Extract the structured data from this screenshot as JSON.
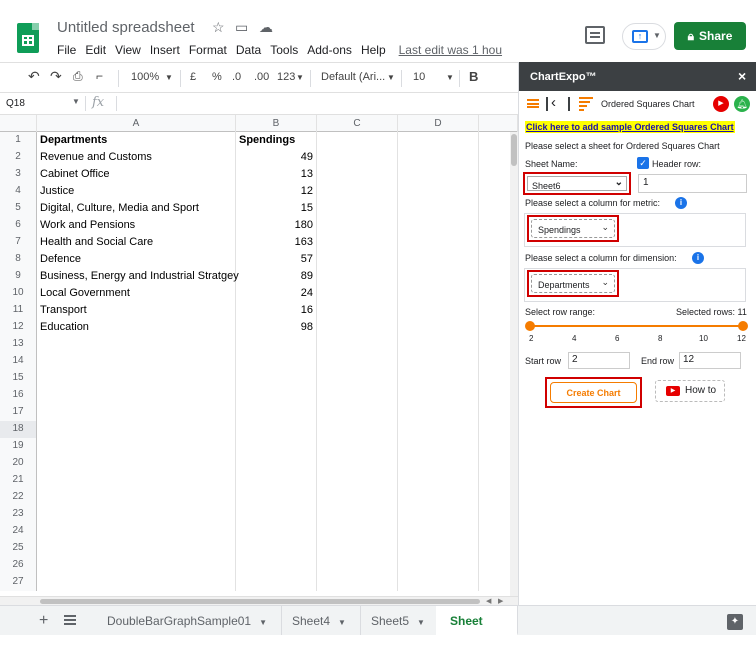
{
  "titlebar": {
    "doc_title": "Untitled spreadsheet",
    "menu": [
      "File",
      "Edit",
      "View",
      "Insert",
      "Format",
      "Data",
      "Tools",
      "Add-ons",
      "Help"
    ],
    "last_edit": "Last edit was 1 hou",
    "share_label": "Share"
  },
  "toolbar": {
    "zoom": "100%",
    "currency": "£",
    "percent": "%",
    "dec_decrease": ".0",
    "dec_increase": ".00",
    "number_format": "123",
    "font": "Default (Ari...",
    "font_size": "10",
    "bold": "B"
  },
  "formula_bar": {
    "cell_ref": "Q18",
    "fx": "fx",
    "value": ""
  },
  "grid": {
    "columns": [
      "A",
      "B",
      "C",
      "D"
    ],
    "header": [
      "Departments",
      "Spendings"
    ],
    "data": [
      [
        "Revenue and Customs",
        "49"
      ],
      [
        "Cabinet Office",
        "13"
      ],
      [
        "Justice",
        "12"
      ],
      [
        "Digital, Culture, Media and Sport",
        "15"
      ],
      [
        "Work and Pensions",
        "180"
      ],
      [
        "Health and Social Care",
        "163"
      ],
      [
        "Defence",
        "57"
      ],
      [
        "Business, Energy and Industrial Stratgey",
        "89"
      ],
      [
        "Local Government",
        "24"
      ],
      [
        "Transport",
        "16"
      ],
      [
        "Education",
        "98"
      ]
    ],
    "row_count": 27,
    "selected_row": 18
  },
  "tabs": {
    "sheets": [
      "DoubleBarGraphSample01",
      "Sheet4",
      "Sheet5",
      "Sheet"
    ],
    "active": "Sheet"
  },
  "panel": {
    "title": "ChartExpo™",
    "close": "×",
    "chart_name": "Ordered Squares Chart",
    "sample_link": "Click here to add sample Ordered Squares Chart",
    "select_sheet_label": "Please select a sheet for Ordered Squares Chart",
    "sheet_name_label": "Sheet Name:",
    "header_row_label": "Header row:",
    "sheet_value": "Sheet6",
    "header_row_value": "1",
    "metric_label": "Please select a column for metric:",
    "metric_value": "Spendings",
    "dimension_label": "Please select a column for dimension:",
    "dimension_value": "Departments",
    "row_range_label": "Select row range:",
    "selected_rows_label": "Selected rows: 11",
    "slider": {
      "min": 2,
      "max": 12,
      "start": 2,
      "end": 12
    },
    "ticks": [
      "2",
      "4",
      "6",
      "8",
      "10",
      "12"
    ],
    "start_row_label": "Start row",
    "start_row_value": "2",
    "end_row_label": "End row",
    "end_row_value": "12",
    "create_label": "Create Chart",
    "howto_label": "How to"
  },
  "colors": {
    "share_green": "#188038",
    "accent_orange": "#f57c00",
    "panel_header": "#3c4043",
    "highlight_red": "#d00000",
    "link_highlight": "#ffff00"
  }
}
